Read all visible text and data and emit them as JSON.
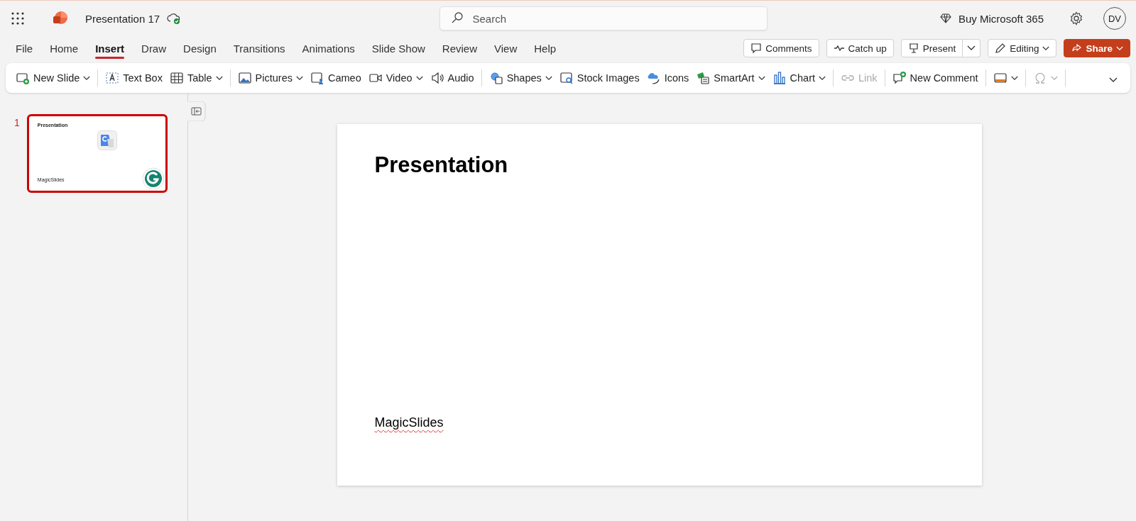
{
  "app": {
    "title": "Presentation 17",
    "search": {
      "placeholder": "Search"
    },
    "buy": "Buy Microsoft 365",
    "avatar": "DV"
  },
  "tabs": [
    {
      "label": "File",
      "selected": false
    },
    {
      "label": "Home",
      "selected": false
    },
    {
      "label": "Insert",
      "selected": true
    },
    {
      "label": "Draw",
      "selected": false
    },
    {
      "label": "Design",
      "selected": false
    },
    {
      "label": "Transitions",
      "selected": false
    },
    {
      "label": "Animations",
      "selected": false
    },
    {
      "label": "Slide Show",
      "selected": false
    },
    {
      "label": "Review",
      "selected": false
    },
    {
      "label": "View",
      "selected": false
    },
    {
      "label": "Help",
      "selected": false
    }
  ],
  "actions": {
    "comments": "Comments",
    "catch_up": "Catch up",
    "present": "Present",
    "editing": "Editing",
    "share": "Share"
  },
  "ribbon": [
    {
      "kind": "button",
      "label": "New Slide",
      "dropdown": true,
      "disabled": false
    },
    {
      "kind": "separator"
    },
    {
      "kind": "button",
      "label": "Text Box",
      "dropdown": false,
      "disabled": false
    },
    {
      "kind": "button",
      "label": "Table",
      "dropdown": true,
      "disabled": false
    },
    {
      "kind": "separator"
    },
    {
      "kind": "button",
      "label": "Pictures",
      "dropdown": true,
      "disabled": false
    },
    {
      "kind": "button",
      "label": "Cameo",
      "dropdown": false,
      "disabled": false
    },
    {
      "kind": "button",
      "label": "Video",
      "dropdown": true,
      "disabled": false
    },
    {
      "kind": "button",
      "label": "Audio",
      "dropdown": false,
      "disabled": false
    },
    {
      "kind": "separator"
    },
    {
      "kind": "button",
      "label": "Shapes",
      "dropdown": true,
      "disabled": false
    },
    {
      "kind": "button",
      "label": "Stock Images",
      "dropdown": false,
      "disabled": false
    },
    {
      "kind": "button",
      "label": "Icons",
      "dropdown": false,
      "disabled": false
    },
    {
      "kind": "button",
      "label": "SmartArt",
      "dropdown": true,
      "disabled": false
    },
    {
      "kind": "button",
      "label": "Chart",
      "dropdown": true,
      "disabled": false
    },
    {
      "kind": "separator"
    },
    {
      "kind": "button",
      "label": "Link",
      "dropdown": false,
      "disabled": true
    },
    {
      "kind": "separator"
    },
    {
      "kind": "button",
      "label": "New Comment",
      "dropdown": false,
      "disabled": false
    },
    {
      "kind": "separator"
    },
    {
      "kind": "button",
      "dropdown": true,
      "disabled": false
    },
    {
      "kind": "separator"
    },
    {
      "kind": "button",
      "dropdown": true,
      "disabled": true
    },
    {
      "kind": "separator"
    }
  ],
  "thumbnails": [
    {
      "number": "1",
      "title": "Presentation",
      "subtitle": "MagicSlides",
      "selected": true
    }
  ],
  "slide": {
    "title": "Presentation",
    "subtitle": "MagicSlides"
  }
}
